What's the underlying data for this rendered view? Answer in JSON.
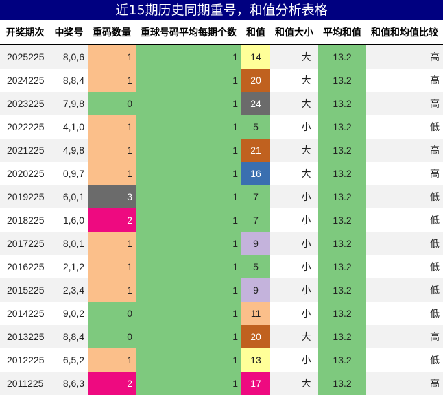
{
  "title": "近15期历史同期重号，和值分析表格",
  "colors": {
    "header_bg": "#000080",
    "green": "#7ec97e",
    "orange": "#fbbf8a",
    "gray": "#6b6b6b",
    "magenta": "#ee0a80",
    "yellow": "#ffff99",
    "brown": "#c0611f",
    "blue": "#3a6fb0",
    "lavender": "#c4b3dc"
  },
  "chart_data": {
    "type": "table",
    "columns": [
      "开奖期次",
      "中奖号",
      "重码数量",
      "重球号码平均每期个数",
      "和值",
      "和值大小",
      "平均和值",
      "和值和均值比较"
    ],
    "rows": [
      {
        "period": "2025225",
        "numbers": "8,0,6",
        "repeat": 1,
        "avg_repeat": 1,
        "sum": 14,
        "size": "大",
        "avg_sum": 13.2,
        "compare": "高",
        "repeat_color": "#fbbf8a",
        "sum_color": "#ffff99"
      },
      {
        "period": "2024225",
        "numbers": "8,8,4",
        "repeat": 1,
        "avg_repeat": 1,
        "sum": 20,
        "size": "大",
        "avg_sum": 13.2,
        "compare": "高",
        "repeat_color": "#fbbf8a",
        "sum_color": "#c0611f"
      },
      {
        "period": "2023225",
        "numbers": "7,9,8",
        "repeat": 0,
        "avg_repeat": 1,
        "sum": 24,
        "size": "大",
        "avg_sum": 13.2,
        "compare": "高",
        "repeat_color": "#7ec97e",
        "sum_color": "#6b6b6b"
      },
      {
        "period": "2022225",
        "numbers": "4,1,0",
        "repeat": 1,
        "avg_repeat": 1,
        "sum": 5,
        "size": "小",
        "avg_sum": 13.2,
        "compare": "低",
        "repeat_color": "#fbbf8a",
        "sum_color": "#7ec97e"
      },
      {
        "period": "2021225",
        "numbers": "4,9,8",
        "repeat": 1,
        "avg_repeat": 1,
        "sum": 21,
        "size": "大",
        "avg_sum": 13.2,
        "compare": "高",
        "repeat_color": "#fbbf8a",
        "sum_color": "#c0611f"
      },
      {
        "period": "2020225",
        "numbers": "0,9,7",
        "repeat": 1,
        "avg_repeat": 1,
        "sum": 16,
        "size": "大",
        "avg_sum": 13.2,
        "compare": "高",
        "repeat_color": "#fbbf8a",
        "sum_color": "#3a6fb0"
      },
      {
        "period": "2019225",
        "numbers": "6,0,1",
        "repeat": 3,
        "avg_repeat": 1,
        "sum": 7,
        "size": "小",
        "avg_sum": 13.2,
        "compare": "低",
        "repeat_color": "#6b6b6b",
        "sum_color": "#7ec97e"
      },
      {
        "period": "2018225",
        "numbers": "1,6,0",
        "repeat": 2,
        "avg_repeat": 1,
        "sum": 7,
        "size": "小",
        "avg_sum": 13.2,
        "compare": "低",
        "repeat_color": "#ee0a80",
        "sum_color": "#7ec97e"
      },
      {
        "period": "2017225",
        "numbers": "8,0,1",
        "repeat": 1,
        "avg_repeat": 1,
        "sum": 9,
        "size": "小",
        "avg_sum": 13.2,
        "compare": "低",
        "repeat_color": "#fbbf8a",
        "sum_color": "#c4b3dc"
      },
      {
        "period": "2016225",
        "numbers": "2,1,2",
        "repeat": 1,
        "avg_repeat": 1,
        "sum": 5,
        "size": "小",
        "avg_sum": 13.2,
        "compare": "低",
        "repeat_color": "#fbbf8a",
        "sum_color": "#7ec97e"
      },
      {
        "period": "2015225",
        "numbers": "2,3,4",
        "repeat": 1,
        "avg_repeat": 1,
        "sum": 9,
        "size": "小",
        "avg_sum": 13.2,
        "compare": "低",
        "repeat_color": "#fbbf8a",
        "sum_color": "#c4b3dc"
      },
      {
        "period": "2014225",
        "numbers": "9,0,2",
        "repeat": 0,
        "avg_repeat": 1,
        "sum": 11,
        "size": "小",
        "avg_sum": 13.2,
        "compare": "低",
        "repeat_color": "#7ec97e",
        "sum_color": "#fbbf8a"
      },
      {
        "period": "2013225",
        "numbers": "8,8,4",
        "repeat": 0,
        "avg_repeat": 1,
        "sum": 20,
        "size": "大",
        "avg_sum": 13.2,
        "compare": "高",
        "repeat_color": "#7ec97e",
        "sum_color": "#c0611f"
      },
      {
        "period": "2012225",
        "numbers": "6,5,2",
        "repeat": 1,
        "avg_repeat": 1,
        "sum": 13,
        "size": "小",
        "avg_sum": 13.2,
        "compare": "低",
        "repeat_color": "#fbbf8a",
        "sum_color": "#ffff99"
      },
      {
        "period": "2011225",
        "numbers": "8,6,3",
        "repeat": 2,
        "avg_repeat": 1,
        "sum": 17,
        "size": "大",
        "avg_sum": 13.2,
        "compare": "高",
        "repeat_color": "#ee0a80",
        "sum_color": "#ee0a80"
      }
    ]
  }
}
